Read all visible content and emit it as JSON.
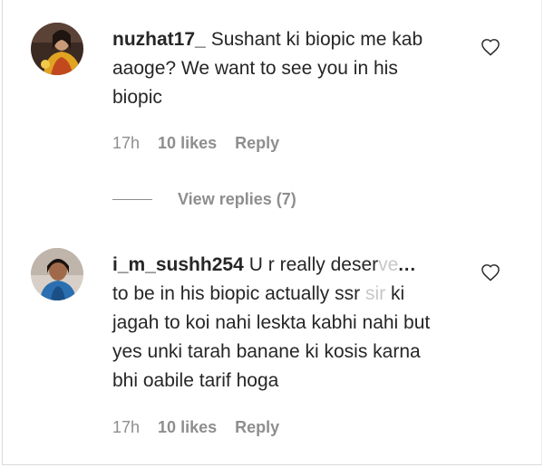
{
  "comments": [
    {
      "username": "nuzhat17_",
      "text": "Sushant ki biopic me kab aaoge? We want to see you in his biopic",
      "time": "17h",
      "likes": "10 likes",
      "reply": "Reply",
      "avatar": "avatar-woman-yellow-outfit"
    },
    {
      "username": "i_m_sushh254",
      "text_lead": "U r really deser",
      "text_fade": "ve",
      "more": "...",
      "text_line2": "to be in his biopic actually ssr",
      "text_line2_fade": "sir",
      "text_rest": "ki jagah to koi nahi leskta kabhi nahi but yes unki tarah banane ki kosis karna bhi oabile tarif hoga",
      "time": "17h",
      "likes": "10 likes",
      "reply": "Reply",
      "avatar": "avatar-woman-blue-top"
    }
  ],
  "view_replies": "View replies (7)",
  "colors": {
    "text": "#262626",
    "secondary": "#8e8e8e",
    "fade": "#c7c7c7"
  },
  "icons": [
    "heart-outline-icon"
  ]
}
